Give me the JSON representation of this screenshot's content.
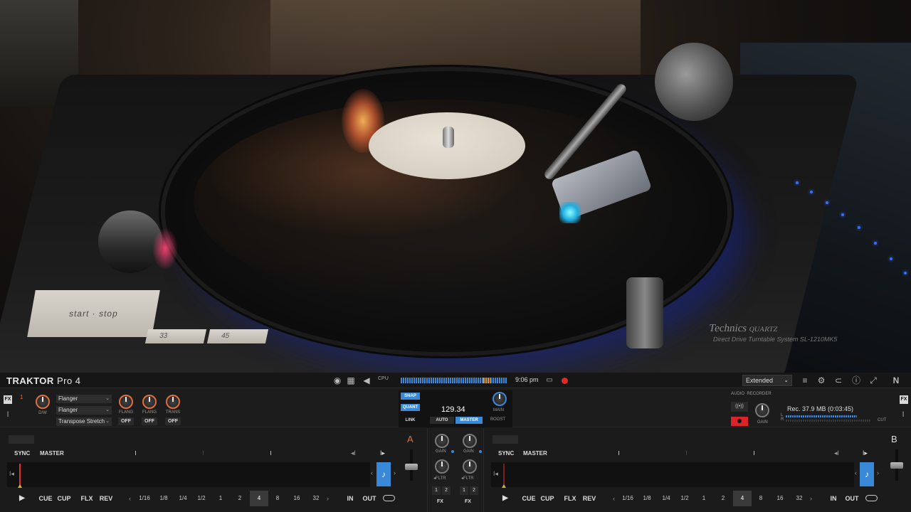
{
  "photo": {
    "start_stop_label": "start · stop",
    "speed_33": "33",
    "speed_45": "45",
    "brand": "Technics",
    "brand_quartz": "QUARTZ",
    "model_text": "Direct Drive Turntable System SL-1210MK5"
  },
  "header": {
    "logo": "TRAKTOR",
    "logo_suffix": "Pro 4",
    "cpu_label": "CPU",
    "clock": "9:06 pm",
    "layout_select": "Extended",
    "colors": {
      "accent": "#3a88d8",
      "deck_a": "#e06f3c",
      "record": "#e02a2a"
    }
  },
  "fx_left": {
    "badge": "FX",
    "unit_number": "1",
    "dw_label": "D/W",
    "slots": [
      "Flanger",
      "Flanger",
      "Transpose Stretch"
    ],
    "knob_labels": [
      "FLANG",
      "FLANG",
      "TRANS"
    ],
    "buttons": [
      "OFF",
      "OFF",
      "OFF"
    ]
  },
  "master_panel": {
    "snap": "SNAP",
    "quant": "QUANT",
    "bpm": "129.34",
    "link": "LINK",
    "auto": "AUTO",
    "master": "MASTER",
    "main": "MAIN",
    "boost": "BOOST"
  },
  "recorder": {
    "label_audio": "AUDIO",
    "label_recorder": "RECORDER",
    "rec_text": "Rec. 37.9 MB (0:03:45)",
    "gain": "GAIN",
    "cut": "CUT",
    "meter_l": "L",
    "meter_r": "R"
  },
  "fx_right": {
    "badge": "FX"
  },
  "deck_a": {
    "letter": "A",
    "sync": "SYNC",
    "master": "MASTER",
    "transport": {
      "cue": "CUE",
      "cup": "CUP",
      "flx": "FLX",
      "rev": "REV",
      "in": "IN",
      "out": "OUT"
    },
    "loop_sizes": [
      "1/16",
      "1/8",
      "1/4",
      "1/2",
      "1",
      "2",
      "4",
      "8",
      "16",
      "32"
    ],
    "active_loop": "4"
  },
  "deck_b": {
    "letter": "B",
    "sync": "SYNC",
    "master": "MASTER",
    "transport": {
      "cue": "CUE",
      "cup": "CUP",
      "flx": "FLX",
      "rev": "REV",
      "in": "IN",
      "out": "OUT"
    },
    "loop_sizes": [
      "1/16",
      "1/8",
      "1/4",
      "1/2",
      "1",
      "2",
      "4",
      "8",
      "16",
      "32"
    ],
    "active_loop": "4"
  },
  "mixer": {
    "gain": "GAIN",
    "filter": "FLTR",
    "fx": "FX",
    "fx_assign": [
      "1",
      "2"
    ]
  }
}
